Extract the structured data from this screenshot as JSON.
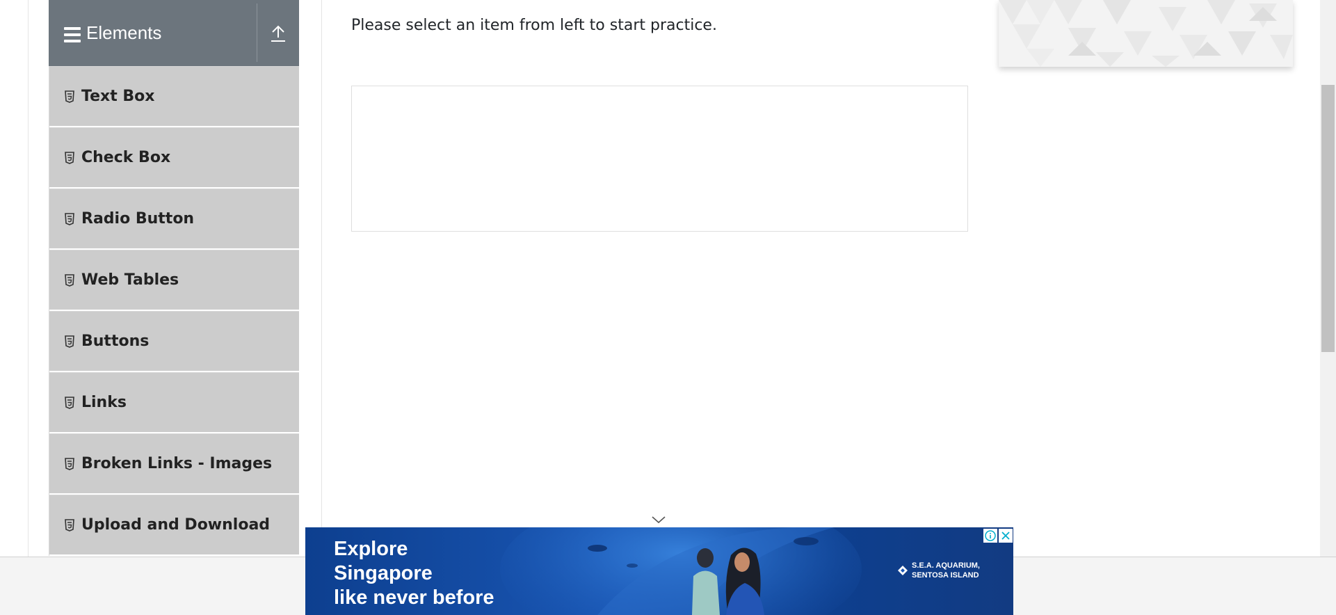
{
  "sidebar": {
    "group_title": "Elements",
    "items": [
      {
        "label": "Text Box",
        "icon": "html5-icon"
      },
      {
        "label": "Check Box",
        "icon": "html5-icon"
      },
      {
        "label": "Radio Button",
        "icon": "html5-icon"
      },
      {
        "label": "Web Tables",
        "icon": "html5-icon"
      },
      {
        "label": "Buttons",
        "icon": "html5-icon"
      },
      {
        "label": "Links",
        "icon": "html5-icon"
      },
      {
        "label": "Broken Links - Images",
        "icon": "html5-icon"
      },
      {
        "label": "Upload and Download",
        "icon": "html5-icon"
      }
    ],
    "header_icons": [
      "hamburger-icon",
      "collapse-up-icon"
    ]
  },
  "main": {
    "instruction": "Please select an item from left to start practice."
  },
  "ad": {
    "headline_lines": [
      "Explore",
      "Singapore",
      "like never before"
    ],
    "brand_lines": [
      "S.E.A. AQUARIUM,",
      "SENTOSA ISLAND"
    ],
    "icons": [
      "ad-info-icon",
      "ad-close-icon",
      "chevron-down-icon"
    ]
  },
  "colors": {
    "sidebar_header": "#6c757d",
    "sidebar_item": "#cccccc",
    "ad_background": "#1a57b5",
    "ad_control": "#00aecd"
  }
}
